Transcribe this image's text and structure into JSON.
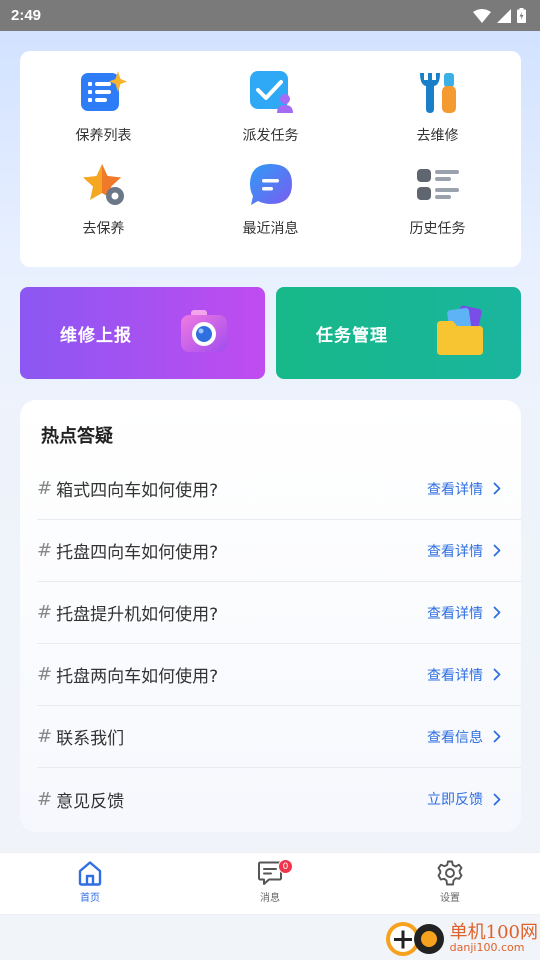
{
  "status_bar": {
    "time": "2:49"
  },
  "quick_actions": [
    {
      "label": "保养列表",
      "icon": "maintenance-list-icon"
    },
    {
      "label": "派发任务",
      "icon": "dispatch-task-icon"
    },
    {
      "label": "去维修",
      "icon": "repair-tools-icon"
    },
    {
      "label": "去保养",
      "icon": "star-gear-icon"
    },
    {
      "label": "最近消息",
      "icon": "chat-bubble-icon"
    },
    {
      "label": "历史任务",
      "icon": "history-list-icon"
    }
  ],
  "banners": {
    "repair_report": {
      "label": "维修上报",
      "icon": "camera-icon"
    },
    "task_manage": {
      "label": "任务管理",
      "icon": "folder-icon"
    }
  },
  "faq": {
    "title": "热点答疑",
    "hash": "#",
    "items": [
      {
        "question": "箱式四向车如何使用?",
        "action": "查看详情"
      },
      {
        "question": "托盘四向车如何使用?",
        "action": "查看详情"
      },
      {
        "question": "托盘提升机如何使用?",
        "action": "查看详情"
      },
      {
        "question": "托盘两向车如何使用?",
        "action": "查看详情"
      },
      {
        "question": "联系我们",
        "action": "查看信息"
      },
      {
        "question": "意见反馈",
        "action": "立即反馈"
      }
    ]
  },
  "tabbar": {
    "home": "首页",
    "messages": "消息",
    "messages_badge": "0",
    "settings": "设置"
  },
  "watermark": {
    "cn": "单机100网",
    "en": "danji100.com"
  },
  "colors": {
    "accent": "#2f6fe0",
    "badge": "#f0344a"
  }
}
